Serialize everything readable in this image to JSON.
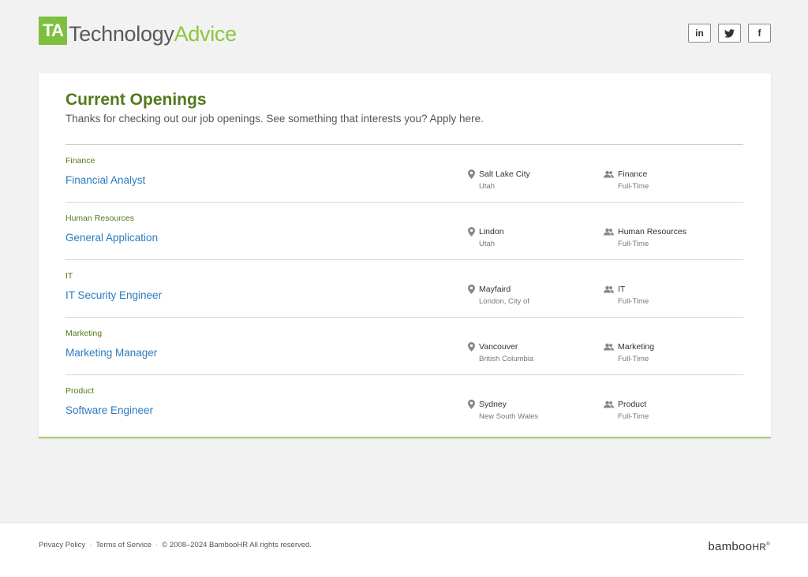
{
  "header": {
    "logo_mark": "TA",
    "logo_word1": "Technology",
    "logo_word2": "Advice",
    "socials": [
      {
        "label": "in",
        "icon": "linkedin-icon"
      },
      {
        "label": "",
        "icon": "twitter-icon"
      },
      {
        "label": "f",
        "icon": "facebook-icon"
      }
    ]
  },
  "openings": {
    "title": "Current Openings",
    "subtitle": "Thanks for checking out our job openings. See something that interests you? Apply here.",
    "jobs": [
      {
        "department": "Finance",
        "title": "Financial Analyst",
        "city": "Salt Lake City",
        "state": "Utah",
        "dept_name": "Finance",
        "type": "Full-Time"
      },
      {
        "department": "Human Resources",
        "title": "General Application",
        "city": "Lindon",
        "state": "Utah",
        "dept_name": "Human Resources",
        "type": "Full-Time"
      },
      {
        "department": "IT",
        "title": "IT Security Engineer",
        "city": "Mayfaird",
        "state": "London, City of",
        "dept_name": "IT",
        "type": "Full-Time"
      },
      {
        "department": "Marketing",
        "title": "Marketing Manager",
        "city": "Vancouver",
        "state": "British Columbia",
        "dept_name": "Marketing",
        "type": "Full-Time"
      },
      {
        "department": "Product",
        "title": "Software Engineer",
        "city": "Sydney",
        "state": "New South Wales",
        "dept_name": "Product",
        "type": "Full-Time"
      }
    ]
  },
  "footer": {
    "privacy": "Privacy Policy",
    "sep": "·",
    "terms": "Terms of Service",
    "copyright": "© 2008–2024 BambooHR All rights reserved.",
    "brand_main": "bamboo",
    "brand_hr": "HR",
    "brand_reg": "®"
  },
  "colors": {
    "accent_green": "#527a1a",
    "logo_green": "#8cc63f",
    "link_blue": "#2b7bbf"
  }
}
